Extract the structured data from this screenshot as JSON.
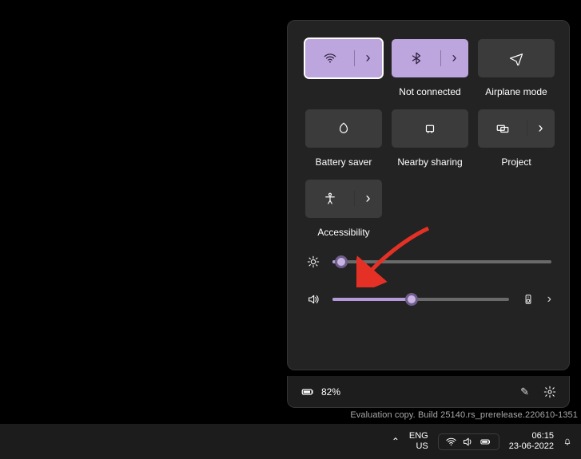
{
  "colors": {
    "accent": "#bda5dd"
  },
  "quick_settings": {
    "tiles": [
      {
        "key": "wifi",
        "label": "",
        "active": true,
        "split": true
      },
      {
        "key": "bluetooth",
        "label": "Not connected",
        "active": true,
        "split": true
      },
      {
        "key": "airplane",
        "label": "Airplane mode",
        "active": false,
        "split": false
      },
      {
        "key": "battery",
        "label": "Battery saver",
        "active": false,
        "split": false
      },
      {
        "key": "nearby",
        "label": "Nearby sharing",
        "active": false,
        "split": false
      },
      {
        "key": "project",
        "label": "Project",
        "active": false,
        "split": true
      },
      {
        "key": "accessibility",
        "label": "Accessibility",
        "active": false,
        "split": true
      }
    ],
    "brightness": 4,
    "volume": 45
  },
  "footer": {
    "battery_pct": "82%"
  },
  "watermark": "Evaluation copy. Build 25140.rs_prerelease.220610-1351",
  "taskbar": {
    "lang_top": "ENG",
    "lang_bottom": "US",
    "time": "06:15",
    "date": "23-06-2022"
  }
}
